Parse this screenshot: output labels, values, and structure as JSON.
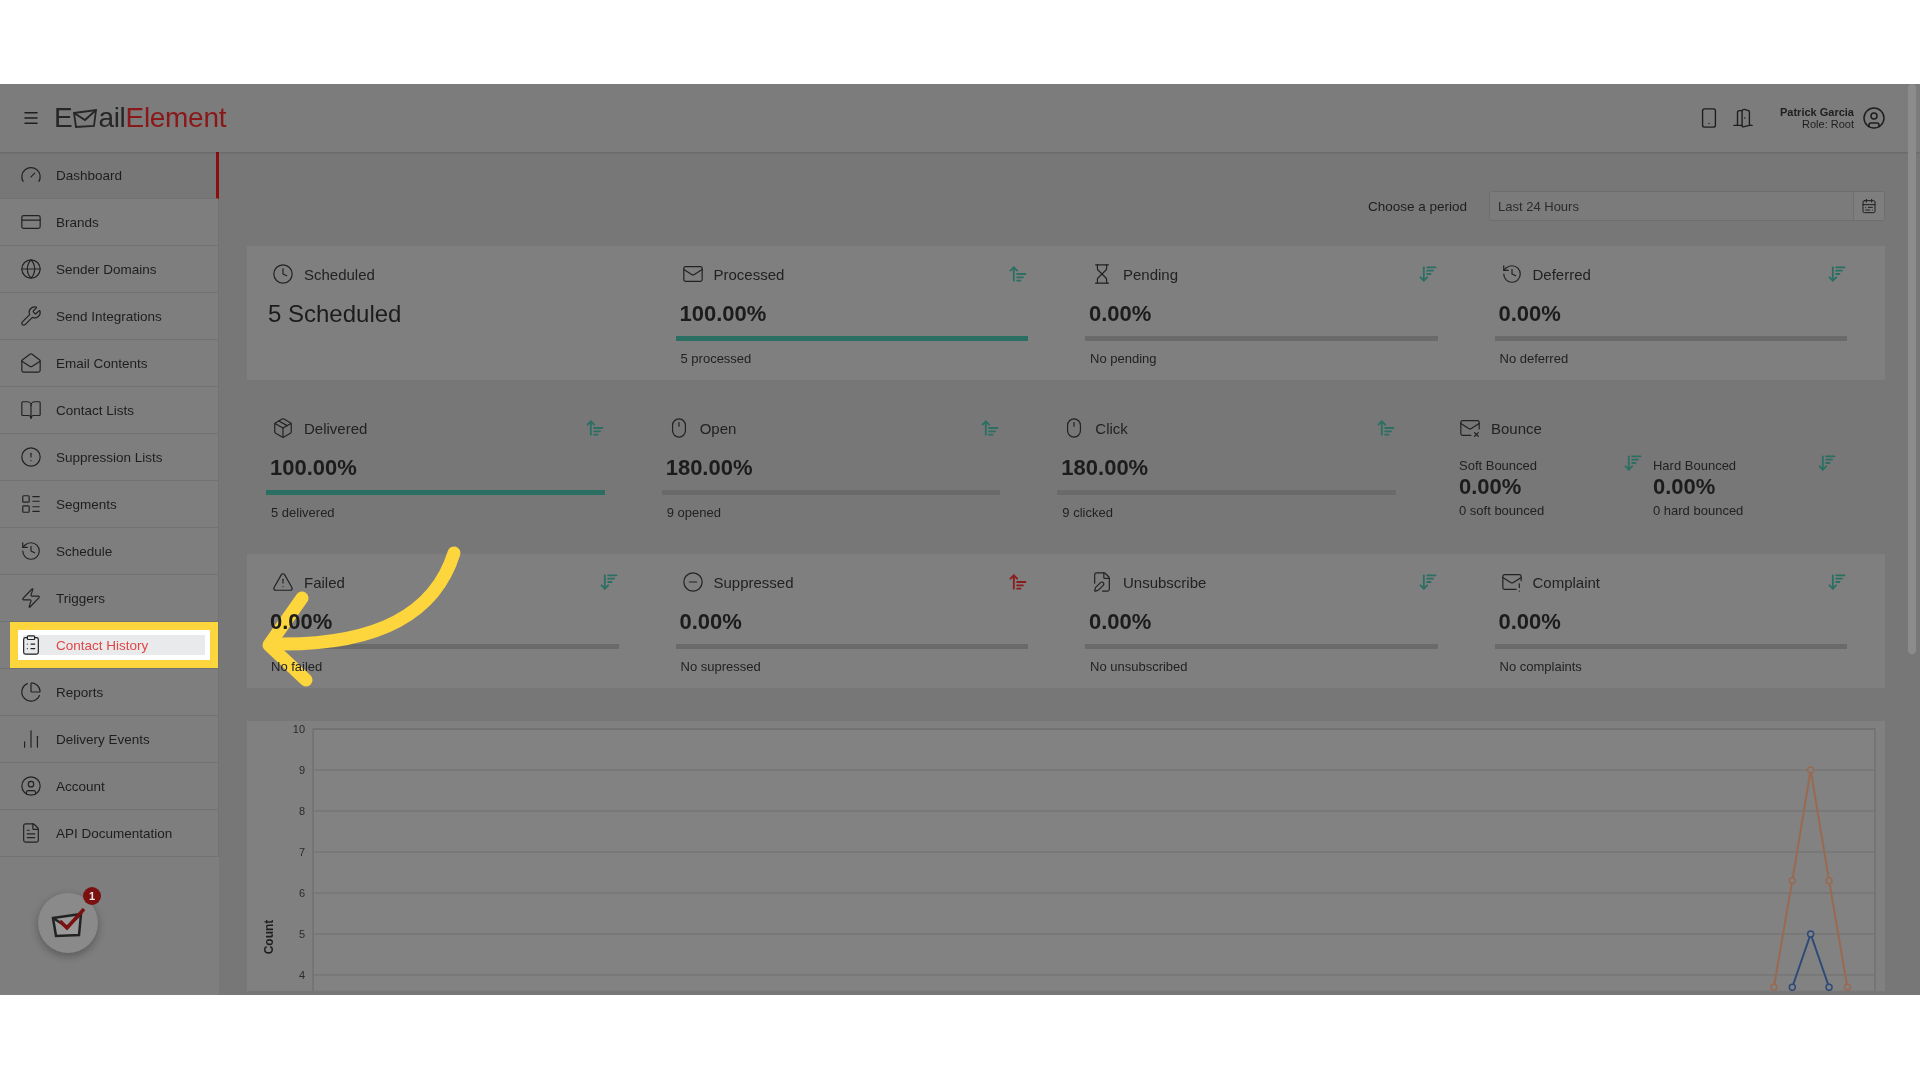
{
  "header": {
    "logo": {
      "prefix": "E",
      "middle": "ail",
      "accent": "Element"
    },
    "user": {
      "name": "Patrick Garcia",
      "role": "Role: Root"
    }
  },
  "sidebar": {
    "items": [
      {
        "label": "Dashboard",
        "selected": true,
        "highlighted": false
      },
      {
        "label": "Brands",
        "selected": false,
        "highlighted": false
      },
      {
        "label": "Sender Domains",
        "selected": false,
        "highlighted": false
      },
      {
        "label": "Send Integrations",
        "selected": false,
        "highlighted": false
      },
      {
        "label": "Email Contents",
        "selected": false,
        "highlighted": false
      },
      {
        "label": "Contact Lists",
        "selected": false,
        "highlighted": false
      },
      {
        "label": "Suppression Lists",
        "selected": false,
        "highlighted": false
      },
      {
        "label": "Segments",
        "selected": false,
        "highlighted": false
      },
      {
        "label": "Schedule",
        "selected": false,
        "highlighted": false
      },
      {
        "label": "Triggers",
        "selected": false,
        "highlighted": false
      },
      {
        "label": "Contact History",
        "selected": false,
        "highlighted": true
      },
      {
        "label": "Reports",
        "selected": false,
        "highlighted": false
      },
      {
        "label": "Delivery Events",
        "selected": false,
        "highlighted": false
      },
      {
        "label": "Account",
        "selected": false,
        "highlighted": false
      },
      {
        "label": "API Documentation",
        "selected": false,
        "highlighted": false
      }
    ],
    "notification_count": "1"
  },
  "period": {
    "label": "Choose a period",
    "value": "Last 24 Hours"
  },
  "rows": [
    {
      "cards": [
        {
          "kind": "count",
          "title": "Scheduled",
          "value": "5 Scheduled"
        },
        {
          "kind": "metric",
          "title": "Processed",
          "value": "100.00%",
          "level": 1,
          "note": "5 processed",
          "sort": {
            "kind": "up",
            "color": "#2b6f63"
          }
        },
        {
          "kind": "metric",
          "title": "Pending",
          "value": "0.00%",
          "level": 0,
          "note": "No pending",
          "sort": {
            "kind": "down",
            "color": "#2b6f63"
          }
        },
        {
          "kind": "metric",
          "title": "Deferred",
          "value": "0.00%",
          "level": 0,
          "note": "No deferred",
          "sort": {
            "kind": "down",
            "color": "#2b6f63"
          }
        }
      ]
    },
    {
      "cards": [
        {
          "kind": "metric",
          "title": "Delivered",
          "value": "100.00%",
          "level": 1,
          "note": "5 delivered",
          "sort": {
            "kind": "up",
            "color": "#2b6f63"
          }
        },
        {
          "kind": "metric",
          "title": "Open",
          "value": "180.00%",
          "level": 0,
          "note": "9 opened",
          "sort": {
            "kind": "up",
            "color": "#2b6f63"
          }
        },
        {
          "kind": "metric",
          "title": "Click",
          "value": "180.00%",
          "level": 0,
          "note": "9 clicked",
          "sort": {
            "kind": "up",
            "color": "#2b6f63"
          }
        },
        {
          "kind": "split",
          "title": "Bounce",
          "parts": [
            {
              "label": "Soft Bounced",
              "value": "0.00%",
              "note": "0 soft bounced",
              "sort": {
                "kind": "down",
                "color": "#2b6f63"
              }
            },
            {
              "label": "Hard Bounced",
              "value": "0.00%",
              "note": "0 hard bounced",
              "sort": {
                "kind": "down",
                "color": "#2b6f63"
              }
            }
          ]
        }
      ]
    },
    {
      "cards": [
        {
          "kind": "metric",
          "title": "Failed",
          "value": "0.00%",
          "level": 0,
          "note": "No failed",
          "sort": {
            "kind": "down",
            "color": "#2b6f63"
          }
        },
        {
          "kind": "metric",
          "title": "Suppressed",
          "value": "0.00%",
          "level": 0,
          "note": "No supressed",
          "sort": {
            "kind": "up",
            "color": "#8b1c1c"
          }
        },
        {
          "kind": "metric",
          "title": "Unsubscribe",
          "value": "0.00%",
          "level": 0,
          "note": "No unsubscribed",
          "sort": {
            "kind": "down",
            "color": "#2b6f63"
          }
        },
        {
          "kind": "metric",
          "title": "Complaint",
          "value": "0.00%",
          "level": 0,
          "note": "No complaints",
          "sort": {
            "kind": "down",
            "color": "#2b6f63"
          }
        }
      ]
    }
  ],
  "chart": {
    "chart_data": {
      "type": "line",
      "ylabel": "Count",
      "ylim": [
        3.6,
        10
      ],
      "yticks": [
        4,
        5,
        6,
        7,
        8,
        9,
        10
      ],
      "grid": true,
      "categories": [
        null,
        null,
        null,
        null,
        null,
        null,
        null,
        null,
        null,
        null,
        null,
        null,
        null,
        null,
        null,
        null,
        null,
        null,
        null,
        null,
        null,
        null,
        null,
        null,
        null,
        null,
        null,
        null,
        null,
        null,
        null,
        null,
        null,
        null,
        null,
        null,
        null,
        null,
        null,
        null,
        null,
        null,
        null,
        null,
        null,
        null,
        null,
        null,
        null,
        null,
        null,
        null,
        null,
        null,
        null,
        null,
        null,
        null,
        null,
        null,
        null,
        null,
        null,
        null,
        null,
        null,
        null,
        null,
        null,
        null,
        null,
        null,
        null,
        null,
        null,
        null,
        null,
        null,
        null,
        null,
        null,
        null,
        null,
        null,
        null
      ],
      "series": [
        {
          "color": "#9a6a50",
          "marker": true,
          "values": [
            null,
            null,
            null,
            null,
            null,
            null,
            null,
            null,
            null,
            null,
            null,
            null,
            null,
            null,
            null,
            null,
            null,
            null,
            null,
            null,
            null,
            null,
            null,
            null,
            null,
            null,
            null,
            null,
            null,
            null,
            null,
            null,
            null,
            null,
            null,
            null,
            null,
            null,
            null,
            null,
            null,
            null,
            null,
            null,
            null,
            null,
            null,
            null,
            null,
            null,
            null,
            null,
            null,
            null,
            null,
            null,
            null,
            null,
            null,
            null,
            null,
            null,
            null,
            null,
            null,
            null,
            null,
            null,
            null,
            null,
            null,
            null,
            null,
            null,
            null,
            null,
            null,
            null,
            null,
            3.7,
            6.3,
            9,
            6.3,
            3.7,
            null
          ]
        },
        {
          "color": "#2d4a78",
          "marker": true,
          "values": [
            null,
            null,
            null,
            null,
            null,
            null,
            null,
            null,
            null,
            null,
            null,
            null,
            null,
            null,
            null,
            null,
            null,
            null,
            null,
            null,
            null,
            null,
            null,
            null,
            null,
            null,
            null,
            null,
            null,
            null,
            null,
            null,
            null,
            null,
            null,
            null,
            null,
            null,
            null,
            null,
            null,
            null,
            null,
            null,
            null,
            null,
            null,
            null,
            null,
            null,
            null,
            null,
            null,
            null,
            null,
            null,
            null,
            null,
            null,
            null,
            null,
            null,
            null,
            null,
            null,
            null,
            null,
            null,
            null,
            null,
            null,
            null,
            null,
            null,
            null,
            null,
            null,
            null,
            null,
            null,
            3.7,
            5,
            3.7,
            null,
            null
          ]
        }
      ]
    }
  }
}
